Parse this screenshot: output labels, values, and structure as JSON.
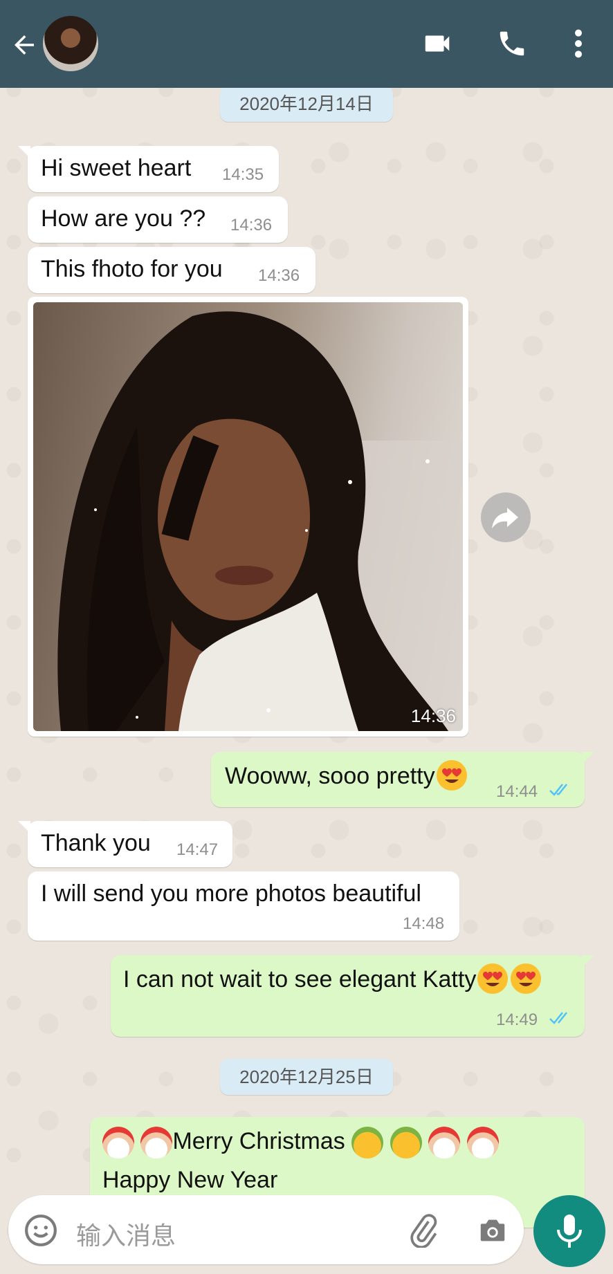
{
  "header": {
    "back_icon": "arrow-left-icon",
    "video_icon": "video-camera-icon",
    "call_icon": "phone-icon",
    "menu_icon": "more-vert-icon",
    "color": "#3b5663"
  },
  "dates": [
    "2020年12月14日",
    "2020年12月25日"
  ],
  "messages": [
    {
      "dir": "in",
      "text": "Hi sweet heart",
      "time": "14:35"
    },
    {
      "dir": "in",
      "text": "How are you ??",
      "time": "14:36"
    },
    {
      "dir": "in",
      "text": "This fhoto for you",
      "time": "14:36"
    },
    {
      "dir": "in",
      "type": "photo",
      "time": "14:36"
    },
    {
      "dir": "out",
      "text": "Wooww, sooo pretty",
      "emoji": [
        "heart-eyes"
      ],
      "time": "14:44",
      "status": "read"
    },
    {
      "dir": "in",
      "text": "Thank you",
      "time": "14:47"
    },
    {
      "dir": "in",
      "text": "I will send you more photos beautiful",
      "time": "14:48"
    },
    {
      "dir": "out",
      "text": "I can not wait to see elegant Katty",
      "emoji": [
        "heart-eyes",
        "heart-eyes"
      ],
      "time": "14:49",
      "status": "read"
    },
    {
      "dir": "out",
      "line1": "Merry Christmas",
      "line2": "Happy New Year",
      "emoji": [
        "santa",
        "santa",
        "party-face",
        "party-face",
        "santa",
        "santa"
      ]
    }
  ],
  "input": {
    "placeholder": "输入消息",
    "emoji_icon": "smiley-icon",
    "attach_icon": "paperclip-icon",
    "camera_icon": "camera-icon",
    "mic_icon": "microphone-icon"
  },
  "colors": {
    "incoming": "#ffffff",
    "outgoing": "#dcf8c6",
    "read_ticks": "#4fc3f7",
    "fab": "#128c7e"
  }
}
